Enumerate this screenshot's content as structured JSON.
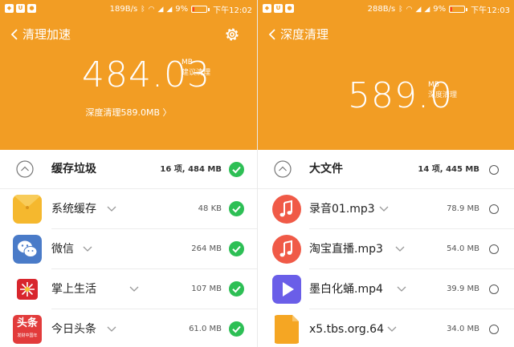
{
  "left": {
    "status": {
      "speed": "189B/s",
      "battery": "9%",
      "time": "下午12:02"
    },
    "title": "清理加速",
    "amount": "484.03",
    "unit": "MB",
    "unit_sub": "建议清理",
    "deep_link": "深度清理589.0MB",
    "section": {
      "label": "缓存垃圾",
      "value": "16 项, 484 MB"
    },
    "items": [
      {
        "label": "系统缓存",
        "value": "48 KB",
        "icon": "folder-icon"
      },
      {
        "label": "微信",
        "value": "264 MB",
        "icon": "wechat-icon"
      },
      {
        "label": "掌上生活",
        "value": "107 MB",
        "icon": "zhangshangshenghuo-icon"
      },
      {
        "label": "今日头条",
        "value": "61.0 MB",
        "icon": "toutiao-icon",
        "icon_text": "头条",
        "icon_sub": "发财中国年"
      }
    ]
  },
  "right": {
    "status": {
      "speed": "288B/s",
      "battery": "9%",
      "time": "下午12:03"
    },
    "title": "深度清理",
    "amount": "589.0",
    "unit": "MB",
    "unit_sub": "深度清理",
    "section": {
      "label": "大文件",
      "value": "14 项, 445 MB"
    },
    "items": [
      {
        "label": "录音01.mp3",
        "value": "78.9 MB",
        "icon": "music-file-icon"
      },
      {
        "label": "淘宝直播.mp3",
        "value": "54.0 MB",
        "icon": "music-file-icon"
      },
      {
        "label": "墨白化蛹.mp4",
        "value": "39.9 MB",
        "icon": "video-file-icon"
      },
      {
        "label": "x5.tbs.org.64",
        "value": "34.0 MB",
        "icon": "file-icon"
      }
    ]
  },
  "colors": {
    "accent": "#f29d24",
    "check_green": "#2dbf55",
    "music_red": "#f05a47",
    "video_purple": "#6a5ee8",
    "file_orange": "#f5a623"
  }
}
